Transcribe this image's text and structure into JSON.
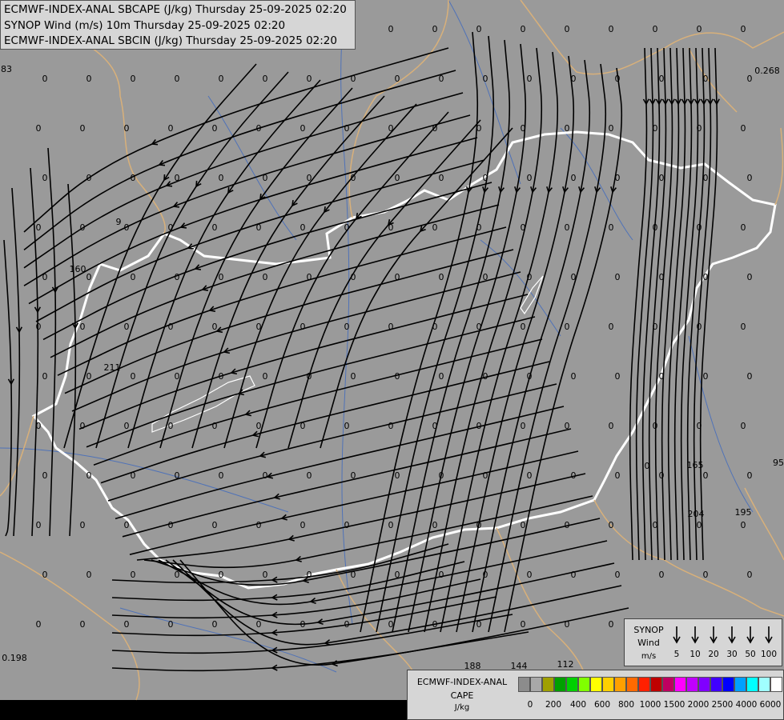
{
  "titles": [
    "ECMWF-INDEX-ANAL SBCAPE (J/kg) Thursday 25-09-2025 02:20",
    "SYNOP Wind (m/s) 10m Thursday 25-09-2025 02:20",
    "ECMWF-INDEX-ANAL SBCIN (J/kg) Thursday 25-09-2025 02:20"
  ],
  "colors": {
    "background": "#9a9a9a",
    "streamline": "#000000",
    "country_border_highlight": "#ffffff",
    "neighbour_border": "#d8b07a",
    "river": "#4f72b8"
  },
  "value_labels": [
    "0",
    "83",
    "0.268",
    "160",
    "211",
    "95",
    "165",
    "204",
    "195",
    "0.198",
    "188",
    "144",
    "112",
    "9",
    "0"
  ],
  "wind_legend": {
    "title_lines": [
      "SYNOP",
      "Wind",
      "m/s"
    ],
    "speeds": [
      "5",
      "10",
      "20",
      "30",
      "50",
      "100"
    ],
    "icon": "wind-arrow-icon"
  },
  "cape_legend": {
    "title_lines": [
      "ECMWF-INDEX-ANAL",
      "CAPE",
      "J/kg"
    ],
    "ticks": [
      "0",
      "200",
      "400",
      "600",
      "800",
      "1000",
      "1500",
      "2000",
      "2500",
      "4000",
      "6000"
    ],
    "swatches": [
      "#8c8c8c",
      "#a8a8a8",
      "#a0a000",
      "#00a000",
      "#00d000",
      "#80ff00",
      "#ffff00",
      "#ffd000",
      "#ffa000",
      "#ff6a00",
      "#ff2000",
      "#c00000",
      "#c00060",
      "#ff00ff",
      "#c000ff",
      "#8000ff",
      "#4000ff",
      "#0000ff",
      "#00a0ff",
      "#00ffff",
      "#a0ffff",
      "#ffffff"
    ]
  }
}
